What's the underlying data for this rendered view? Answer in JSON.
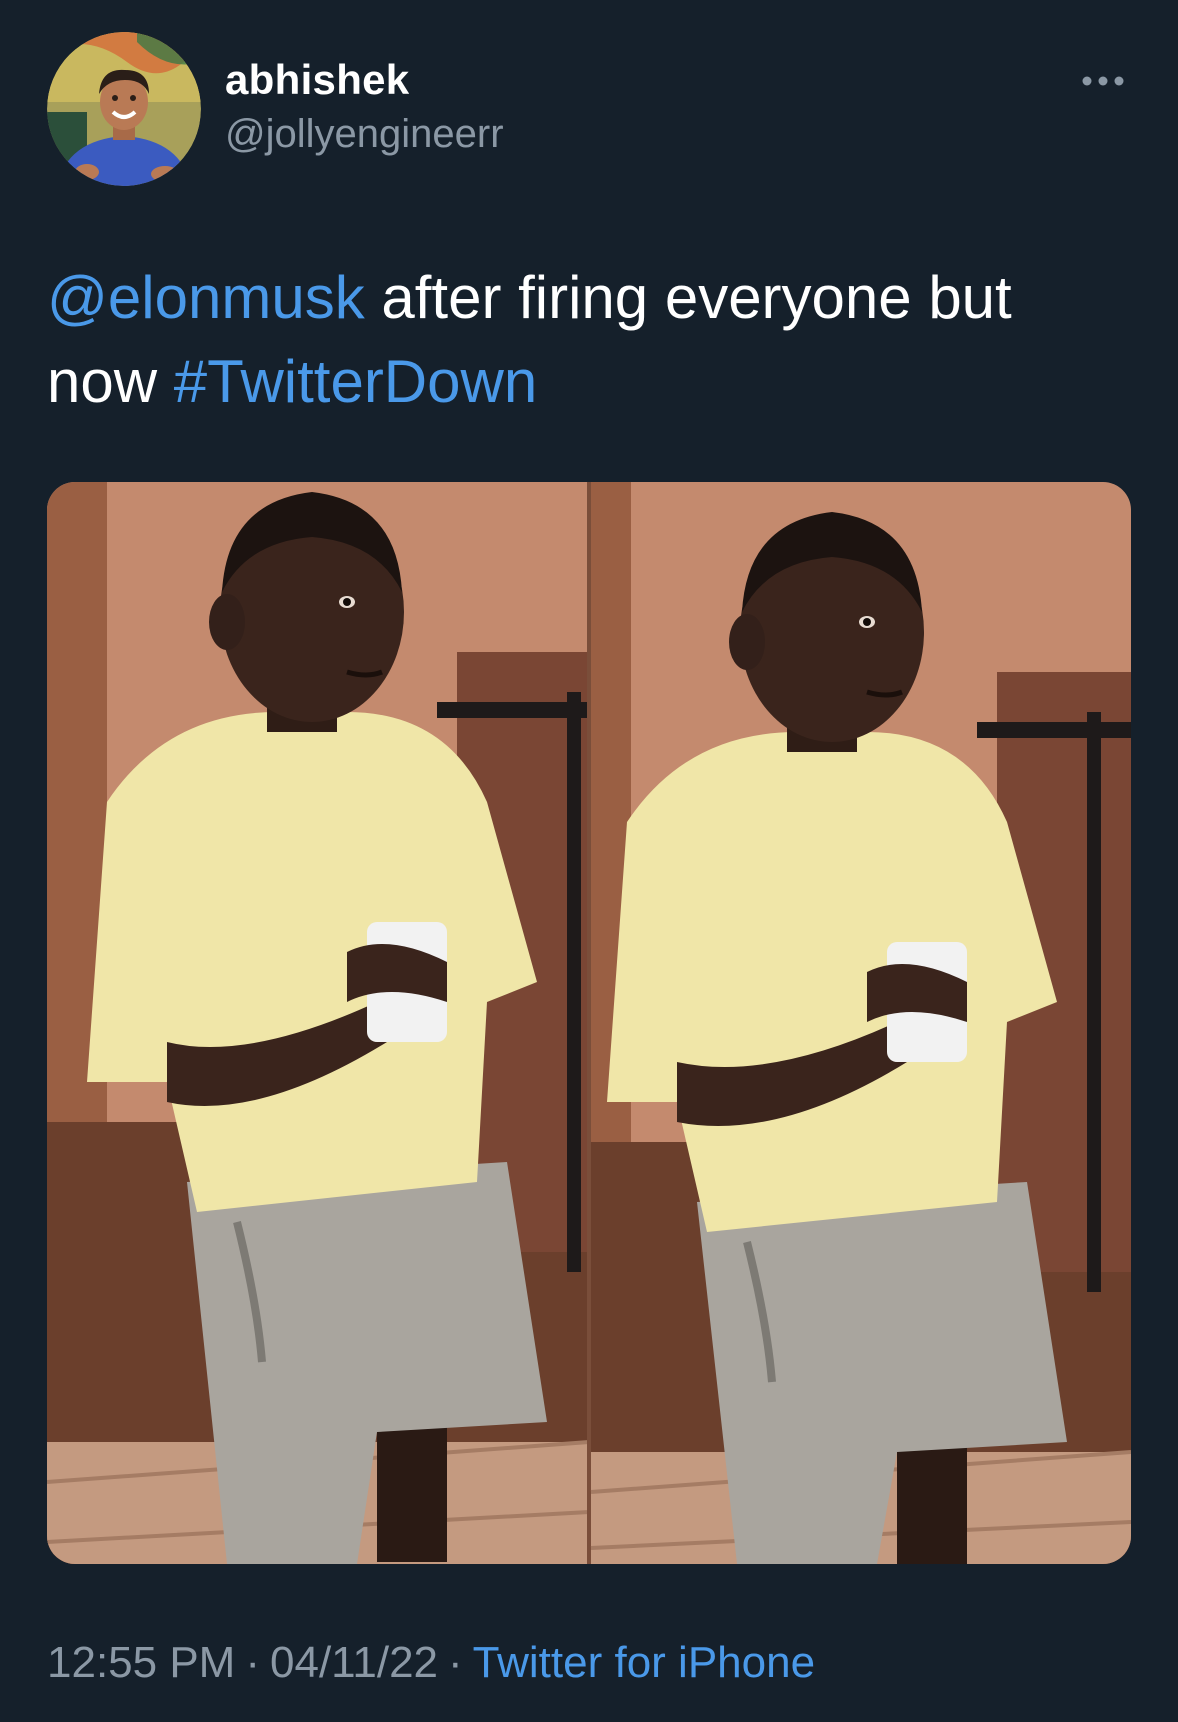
{
  "author": {
    "display_name": "abhishek",
    "handle": "@jollyengineerr",
    "avatar_icon": "profile-photo"
  },
  "more_icon": "ellipsis-icon",
  "tweet": {
    "mention": "@elonmusk",
    "text_after_mention": " after firing everyone but now ",
    "hashtag": "#TwitterDown"
  },
  "media": {
    "type": "photo",
    "panels": 2
  },
  "meta": {
    "time": "12:55 PM",
    "date": "04/11/22",
    "separator": "·",
    "source": "Twitter for iPhone"
  },
  "colors": {
    "background": "#15202b",
    "link": "#4a99e9",
    "secondary_text": "#8b98a5"
  }
}
